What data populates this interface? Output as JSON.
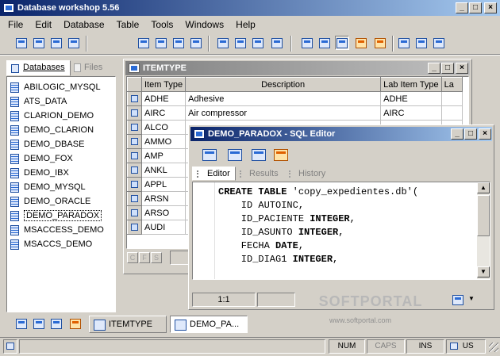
{
  "app": {
    "title": "Database workshop 5.56",
    "title_buttons": [
      "_",
      "□",
      "×"
    ]
  },
  "menu": [
    "File",
    "Edit",
    "Database",
    "Table",
    "Tools",
    "Windows",
    "Help"
  ],
  "toolbar": {
    "icons": [
      "new-icon",
      "open-icon",
      "new-table-icon",
      "save-icon",
      "query-icon",
      "form-icon",
      "sort-az-icon",
      "sort-za-icon",
      "filter-icon",
      "sql-icon",
      "comment-icon",
      "editor-icon",
      "plugin-icon",
      "config-icon",
      "cascade-icon",
      "tile-horizontal-icon",
      "tile-vertical-icon"
    ]
  },
  "left_panel": {
    "tabs": [
      "Databases",
      "Files"
    ],
    "databases": [
      "ABILOGIC_MYSQL",
      "ATS_DATA",
      "CLARION_DEMO",
      "DEMO_CLARION",
      "DEMO_DBASE",
      "DEMO_FOX",
      "DEMO_IBX",
      "DEMO_MYSQL",
      "DEMO_ORACLE",
      "DEMO_PARADOX",
      "MSACCESS_DEMO",
      "MSACCS_DEMO"
    ],
    "selected": "DEMO_PARADOX"
  },
  "itemtype_window": {
    "title": "ITEMTYPE",
    "columns": [
      "Item Type",
      "Description",
      "Lab Item Type",
      "La"
    ],
    "rows": [
      [
        "ADHE",
        "Adhesive",
        "ADHE"
      ],
      [
        "AIRC",
        "Air compressor",
        "AIRC"
      ],
      [
        "ALCO",
        "",
        ""
      ],
      [
        "AMMO",
        "",
        ""
      ],
      [
        "AMP",
        "",
        ""
      ],
      [
        "ANKL",
        "",
        ""
      ],
      [
        "APPL",
        "",
        ""
      ],
      [
        "ARSN",
        "",
        ""
      ],
      [
        "ARSO",
        "",
        ""
      ],
      [
        "AUDI",
        "",
        ""
      ]
    ],
    "nav_buttons": [
      "C",
      "F",
      "S"
    ]
  },
  "sql_editor": {
    "title": "DEMO_PARADOX - SQL Editor",
    "tabs": [
      "Editor",
      "Results",
      "History"
    ],
    "lines": [
      {
        "kw": "CREATE TABLE",
        "rest": " 'copy_expedientes.db'("
      },
      {
        "kw": "",
        "rest": "    ID AUTOINC,"
      },
      {
        "kw": "",
        "rest": "    ID_PACIENTE ",
        "kw2": "INTEGER",
        "tail": ","
      },
      {
        "kw": "",
        "rest": "    ID_ASUNTO ",
        "kw2": "INTEGER",
        "tail": ","
      },
      {
        "kw": "",
        "rest": "    FECHA ",
        "kw2": "DATE",
        "tail": ","
      },
      {
        "kw": "",
        "rest": "    ID_DIAG1 ",
        "kw2": "INTEGER",
        "tail": ","
      }
    ],
    "cursor_pos": "1:1"
  },
  "taskbar": {
    "windows": [
      "ITEMTYPE",
      "DEMO_PA..."
    ]
  },
  "statusbar": {
    "num": "NUM",
    "caps": "CAPS",
    "ins": "INS",
    "lang": "US"
  },
  "watermark": {
    "brand": "SOFTPORTAL",
    "url": "www.softportal.com"
  }
}
